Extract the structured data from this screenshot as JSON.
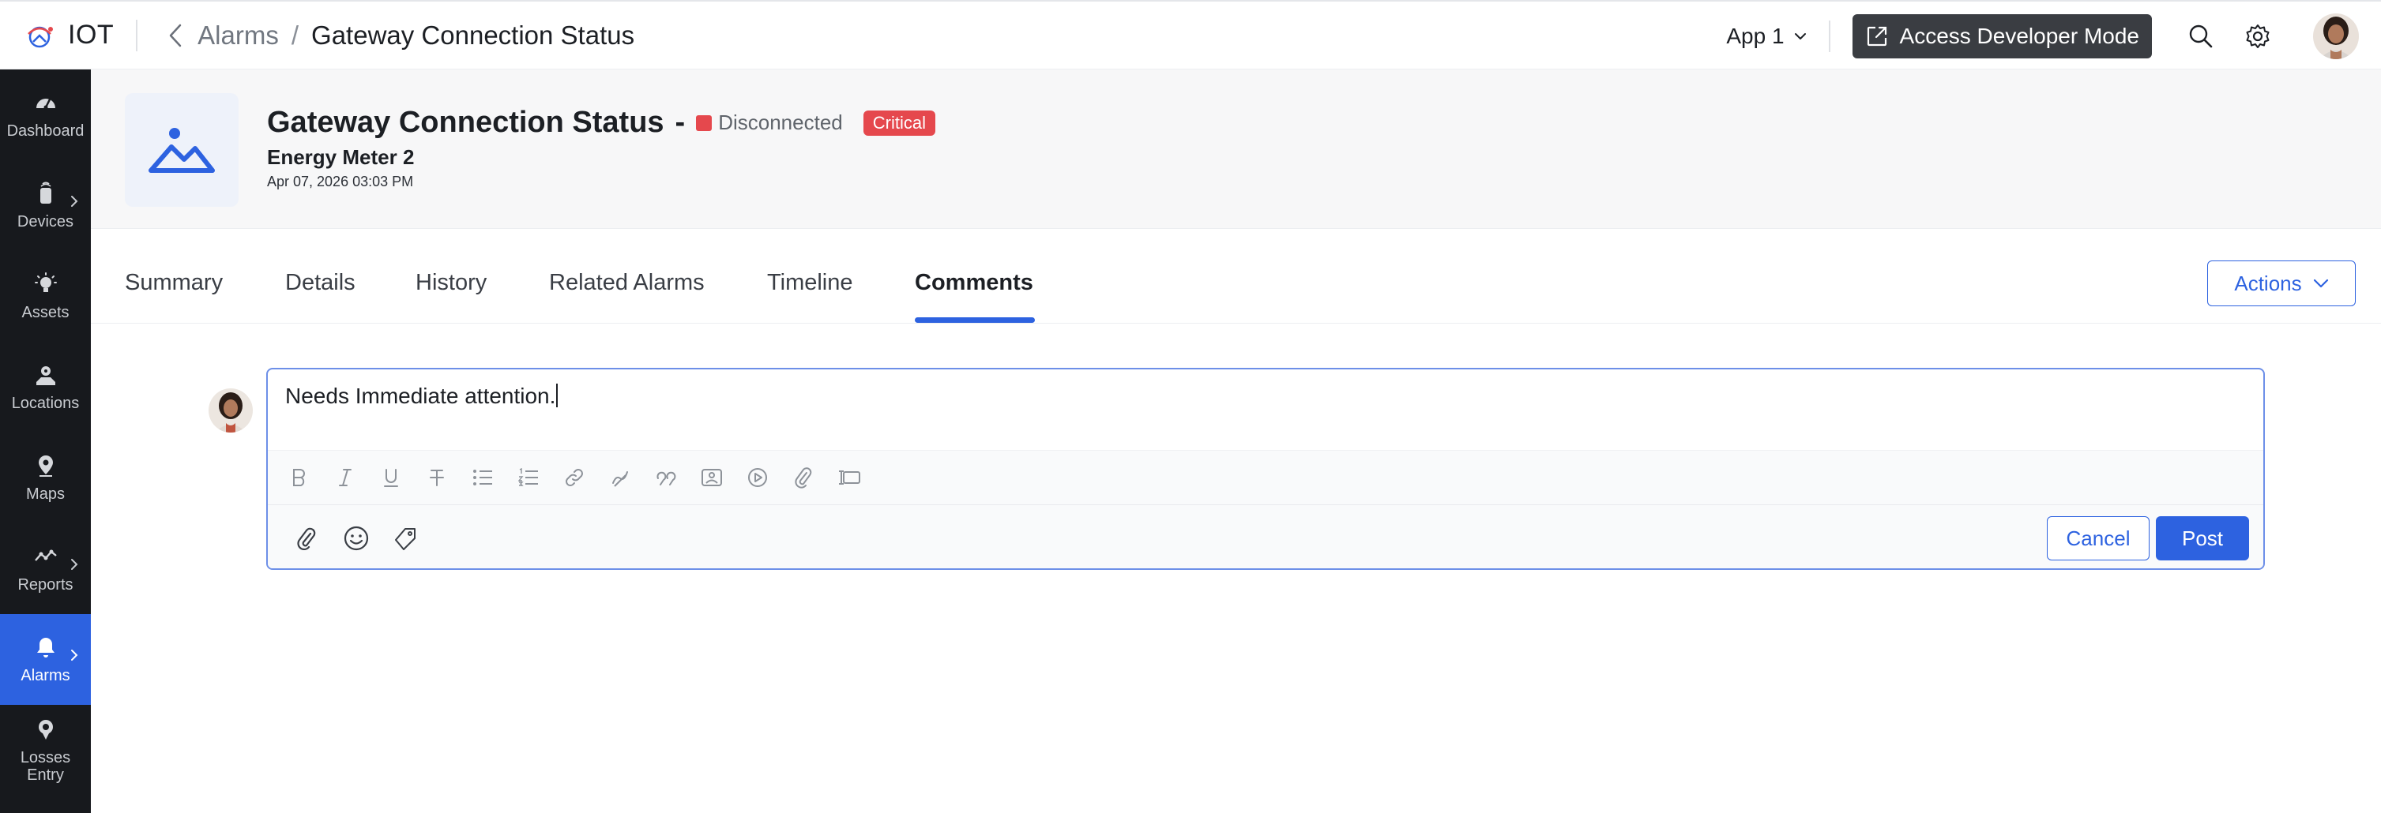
{
  "topbar": {
    "brand": "IOT",
    "breadcrumb_parent": "Alarms",
    "breadcrumb_separator": "/",
    "breadcrumb_current": "Gateway Connection Status",
    "app_selector": "App 1",
    "dev_mode_label": "Access Developer Mode"
  },
  "sidebar": {
    "items": [
      {
        "label": "Dashboard",
        "icon": "dashboard-icon"
      },
      {
        "label": "Devices",
        "icon": "device-icon"
      },
      {
        "label": "Assets",
        "icon": "bulb-icon"
      },
      {
        "label": "Locations",
        "icon": "location-icon"
      },
      {
        "label": "Maps",
        "icon": "map-pin-icon"
      },
      {
        "label": "Reports",
        "icon": "trend-icon"
      },
      {
        "label": "Alarms",
        "icon": "bell-icon",
        "active": true
      },
      {
        "label": "Losses Entry",
        "icon": "losses-icon"
      }
    ]
  },
  "alarm": {
    "title": "Gateway Connection Status",
    "dash": "-",
    "status": "Disconnected",
    "severity": "Critical",
    "device": "Energy Meter 2",
    "timestamp": "Apr 07, 2026 03:03 PM"
  },
  "tabs": [
    {
      "label": "Summary"
    },
    {
      "label": "Details"
    },
    {
      "label": "History"
    },
    {
      "label": "Related Alarms"
    },
    {
      "label": "Timeline"
    },
    {
      "label": "Comments",
      "active": true
    }
  ],
  "actions_label": "Actions",
  "comment": {
    "text": "Needs Immediate attention.",
    "cancel_label": "Cancel",
    "post_label": "Post"
  },
  "colors": {
    "accent": "#2d62e0",
    "sidebar_bg": "#17191d",
    "critical": "#e5484d",
    "dev_mode_bg": "#3a3d42"
  }
}
